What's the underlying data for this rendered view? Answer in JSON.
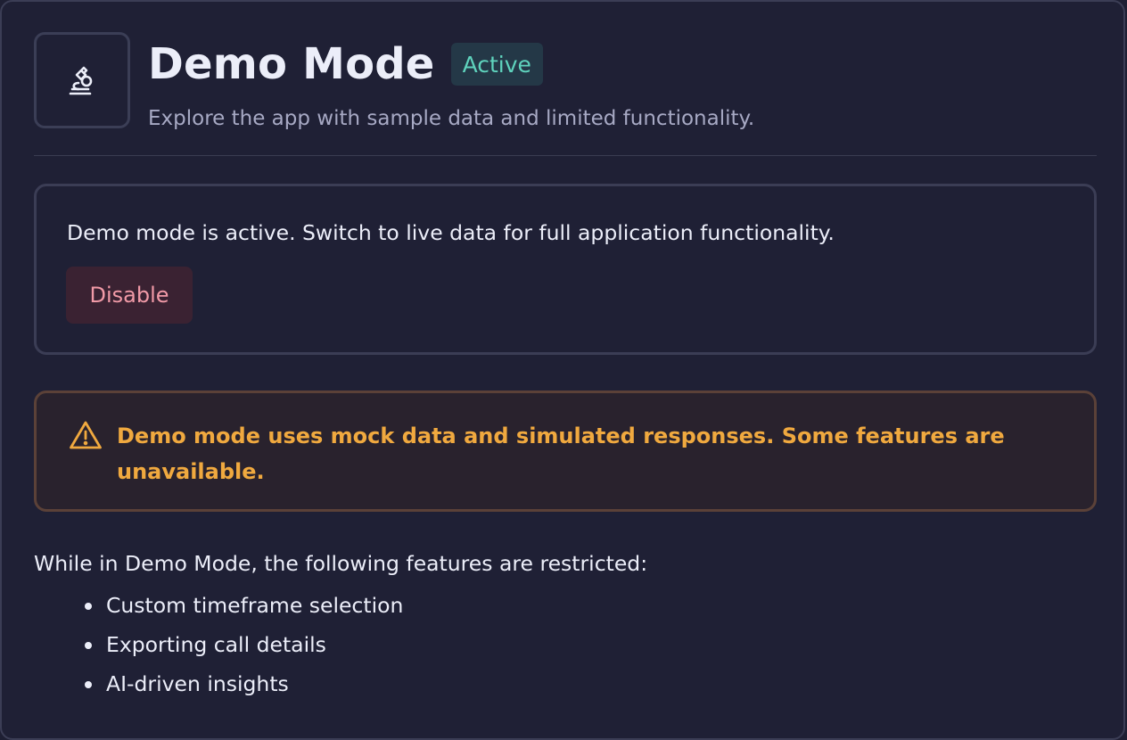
{
  "header": {
    "title": "Demo Mode",
    "badge": "Active",
    "subtitle": "Explore the app with sample data and limited functionality.",
    "icon": "microscope-icon"
  },
  "status_card": {
    "message": "Demo mode is active. Switch to live data for full application functionality.",
    "disable_label": "Disable"
  },
  "warning": {
    "icon": "warning-triangle-icon",
    "message": "Demo mode uses mock data and simulated responses. Some features are unavailable."
  },
  "restrictions": {
    "intro": "While in Demo Mode, the following features are restricted:",
    "items": [
      "Custom timeframe selection",
      "Exporting call details",
      "AI-driven insights"
    ]
  },
  "colors": {
    "background": "#1f2035",
    "badge_text": "#5fd3bd",
    "disable_text": "#f19aa7",
    "warning_text": "#f0a93f"
  }
}
